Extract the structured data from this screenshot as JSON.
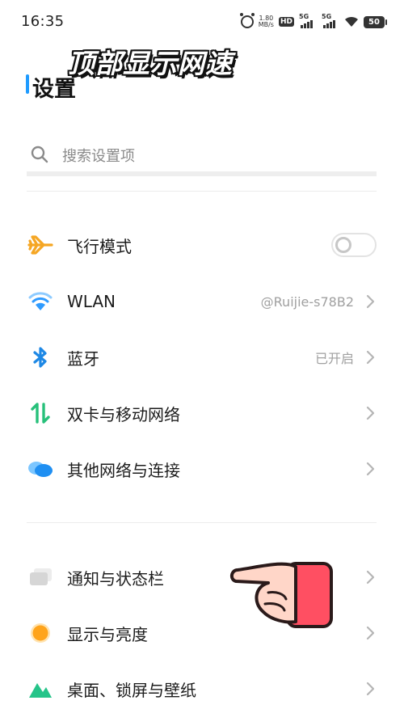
{
  "status_bar": {
    "time": "16:35",
    "net_speed_value": "1.80",
    "net_speed_unit": "MB/s",
    "hd_label": "HD",
    "hd_sub": "1 2",
    "sim1_label": "5G",
    "sim2_label": "5G",
    "battery": "50",
    "icons": [
      "alarm-icon",
      "hd-icon",
      "signal-icon",
      "signal-icon",
      "wifi-icon",
      "battery-icon"
    ]
  },
  "overlay": {
    "caption": "顶部显示网速"
  },
  "header": {
    "title": "设置",
    "accent_color": "#1f9bff"
  },
  "search": {
    "placeholder": "搜索设置项"
  },
  "groups": {
    "network": [
      {
        "name": "airplane-mode",
        "icon": "airplane-icon",
        "label": "飞行模式",
        "control": "toggle",
        "toggle_on": false
      },
      {
        "name": "wlan",
        "icon": "wifi-icon",
        "label": "WLAN",
        "value": "@Ruijie-s78B2",
        "control": "chevron"
      },
      {
        "name": "bluetooth",
        "icon": "bluetooth-icon",
        "label": "蓝牙",
        "value": "已开启",
        "control": "chevron"
      },
      {
        "name": "dual-sim",
        "icon": "dual-sim-icon",
        "label": "双卡与移动网络",
        "control": "chevron"
      },
      {
        "name": "other-networks",
        "icon": "cloud-link-icon",
        "label": "其他网络与连接",
        "control": "chevron"
      }
    ],
    "display": [
      {
        "name": "notifications",
        "icon": "notification-icon",
        "label": "通知与状态栏",
        "control": "chevron"
      },
      {
        "name": "display-brightness",
        "icon": "brightness-icon",
        "label": "显示与亮度",
        "control": "chevron"
      },
      {
        "name": "desktop-wallpaper",
        "icon": "wallpaper-icon",
        "label": "桌面、锁屏与壁纸",
        "control": "chevron"
      }
    ]
  },
  "colors": {
    "airplane": "#f5a623",
    "wifi": "#2f9bff",
    "bluetooth": "#1e88e5",
    "dual_sim": "#27c07a",
    "other_networks": "#1f8ff2",
    "notifications": "#d9d9d9",
    "brightness": "#ffa41b",
    "wallpaper": "#25c489",
    "pointer_hand": "#ff4f62"
  }
}
